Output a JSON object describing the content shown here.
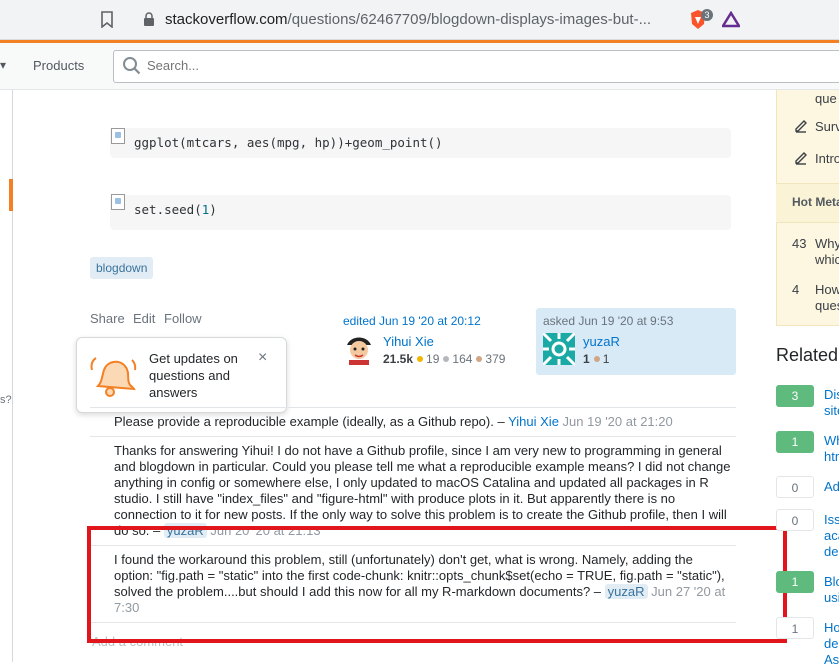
{
  "browser": {
    "url_host": "stackoverflow.com",
    "url_path": "/questions/62467709/blogdown-displays-images-but-...",
    "shield_count": "3"
  },
  "header": {
    "products_label": "Products",
    "search_placeholder": "Search..."
  },
  "left_nav": {
    "clipped_text": "s?"
  },
  "post": {
    "code_blocks": [
      {
        "text": "ggplot(mtcars, aes(mpg, hp))+geom_point()"
      },
      {
        "prefix": "set.seed(",
        "num": "1",
        "suffix": ")"
      }
    ],
    "tag": "blogdown",
    "menu": {
      "share": "Share",
      "edit": "Edit",
      "follow": "Follow"
    },
    "editor": {
      "action": "edited Jun 19 '20 at 20:12",
      "name": "Yihui Xie",
      "rep": "21.5k",
      "gold": "19",
      "silver": "164",
      "bronze": "379"
    },
    "owner": {
      "action": "asked Jun 19 '20 at 9:53",
      "name": "yuzaR",
      "rep": "1",
      "bronze": "1"
    }
  },
  "popover": {
    "text": "Get updates on questions and answers",
    "close": "×"
  },
  "comments": [
    {
      "text": "Please provide a reproducible example (ideally, as a Github repo). –",
      "user": "Yihui Xie",
      "date": "Jun 19 '20 at 21:20"
    },
    {
      "text": "Thanks for answering Yihui! I do not have a Github profile, since I am very new to programming in general and blogdown in particular. Could you please tell me what a reproducible example means? I did not change anything in config or somewhere else, I only updated to macOS Catalina and updated all packages in R studio. I still have \"index_files\" and \"figure-html\" with produce plots in it. But apparently there is no connection to it for new posts. If the only way to solve this problem is to create the Github profile, then I will do so. –",
      "user": "yuzaR",
      "date": "Jun 20 '20 at 21:13"
    },
    {
      "text": "I found the workaround this problem, still (unfortunately) don't get, what is wrong. Namely, adding the option: \"fig.path = \"static\" into the first code-chunk: knitr::opts_chunk$set(echo = TRUE, fig.path = \"static\"), solved the problem....but should I add this now for all my R-markdown documents? –",
      "user": "yuzaR",
      "date": "Jun 27 '20 at 7:30"
    }
  ],
  "add_comment": "Add a comment",
  "sidebar": {
    "blog_items": [
      "que",
      "Surv",
      "Intro"
    ],
    "hot_meta_title": "Hot Meta",
    "hot_meta_items": [
      {
        "count": "43",
        "line1": "Why",
        "line2": "whic"
      },
      {
        "count": "4",
        "line1": "How",
        "line2": "ques"
      }
    ],
    "related_title": "Related",
    "related": [
      {
        "count": "3",
        "answered": true,
        "line1": "Dis",
        "line2": "site"
      },
      {
        "count": "1",
        "answered": true,
        "line1": "Wh",
        "line2": "htm"
      },
      {
        "count": "0",
        "answered": false,
        "line1": "Ad",
        "line2": ""
      },
      {
        "count": "0",
        "answered": false,
        "line1": "Iss",
        "line2": "aca",
        "line3": "de"
      },
      {
        "count": "1",
        "answered": true,
        "line1": "Blo",
        "line2": "usi"
      },
      {
        "count": "1",
        "answered": false,
        "line1": "Ho",
        "line2": "de",
        "line3": "As"
      }
    ]
  },
  "colors": {
    "accent": "#f48024",
    "link": "#0074cc",
    "highlight": "#e0161c",
    "answered": "#5eba7d"
  }
}
